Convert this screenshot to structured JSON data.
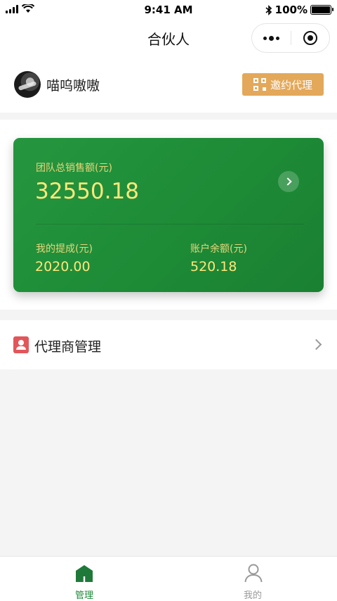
{
  "status_bar": {
    "time": "9:41 AM",
    "battery": "100%"
  },
  "nav": {
    "title": "合伙人"
  },
  "user": {
    "name": "喵呜嗷嗷",
    "invite_label": "邀约代理"
  },
  "card": {
    "total_label": "团队总销售额(元)",
    "total_value": "32550.18",
    "commission_label": "我的提成(元)",
    "commission_value": "2020.00",
    "balance_label": "账户余额(元)",
    "balance_value": "520.18"
  },
  "menu": {
    "agent_label": "代理商管理"
  },
  "tabs": [
    {
      "label": "管理",
      "icon": "house-icon",
      "active": true
    },
    {
      "label": "我的",
      "icon": "person-icon",
      "active": false
    }
  ],
  "colors": {
    "card_green": "#1f8a3a",
    "value_yellow": "#ffe77a",
    "invite_orange": "#e3a85a",
    "agent_red": "#e2565a"
  }
}
